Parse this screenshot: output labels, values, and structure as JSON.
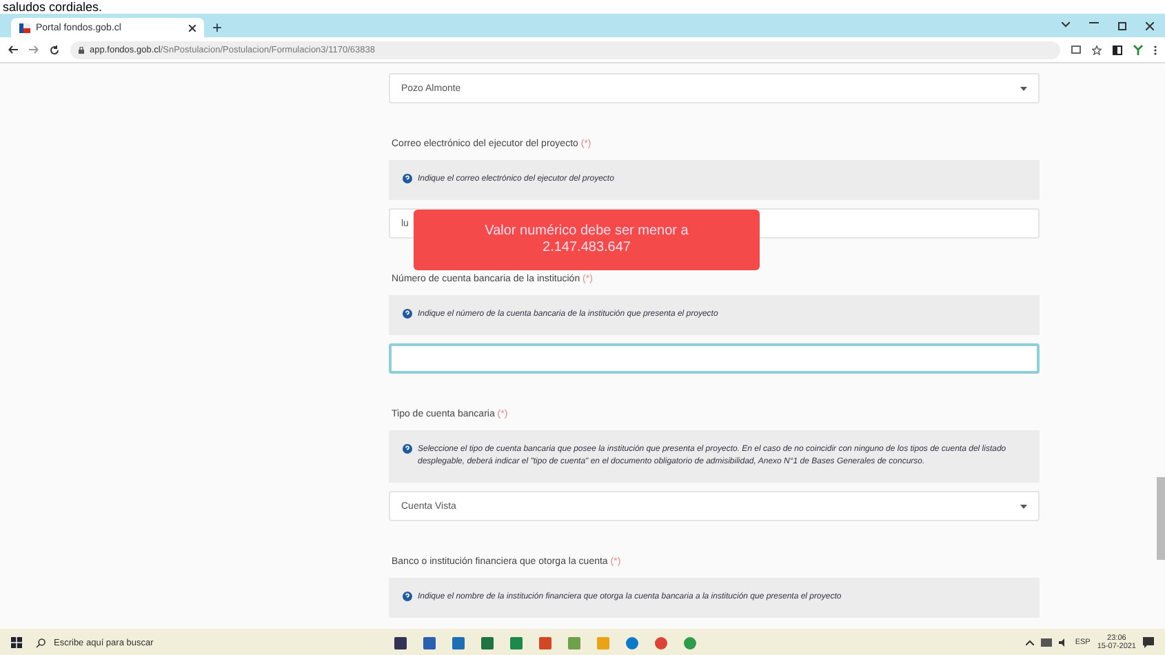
{
  "caption": "saludos cordiales.",
  "browser": {
    "tabs": [
      {
        "title": "Portal fondos.gob.cl",
        "selected": true
      }
    ],
    "new_tab": "+",
    "url": "app.fondos.gob.cl/SnPostulacion/Postulacion/Formulacion3/1170/63838"
  },
  "form": [
    {
      "control": {
        "kind": "select",
        "value": "Pozo Almonte",
        "focused": false
      }
    },
    {
      "label": "Correo electrónico del ejecutor del proyecto",
      "mark": "(*)",
      "hint": "Indique el correo electrónico del ejecutor del proyecto",
      "control": {
        "kind": "text",
        "value": "lu",
        "focused": false
      }
    },
    {
      "label": "Número de cuenta bancaria de la institución",
      "mark": "(*)",
      "hint": "Indique el número de la cuenta bancaria de la institución que presenta el proyecto",
      "control": {
        "kind": "text",
        "focused": true
      }
    },
    {
      "label": "Tipo de cuenta bancaria",
      "mark": "(*)",
      "hint": "Seleccione el tipo de cuenta bancaria que posee la institución que presenta el proyecto. En el caso de no coincidir con ninguno de los tipos de cuenta del listado desplegable, deberá indicar el \"tipo de cuenta\" en el documento obligatorio de admisibilidad, Anexo N°1 de Bases Generales de concurso.",
      "control": {
        "kind": "select",
        "value": "Cuenta Vista",
        "focused": false
      }
    },
    {
      "label": "Banco o institución financiera que otorga la cuenta",
      "mark": "(*)",
      "hint": "Indique el nombre de la institución financiera que otorga la cuenta bancaria a la institución que presenta el proyecto"
    }
  ],
  "toast": {
    "message": "Valor numérico debe ser menor a 2.147.483.647"
  },
  "taskbar": {
    "search_placeholder": "Escribe aquí para buscar",
    "language": "ESP",
    "time": "23:06",
    "date": "15-07-2021"
  }
}
